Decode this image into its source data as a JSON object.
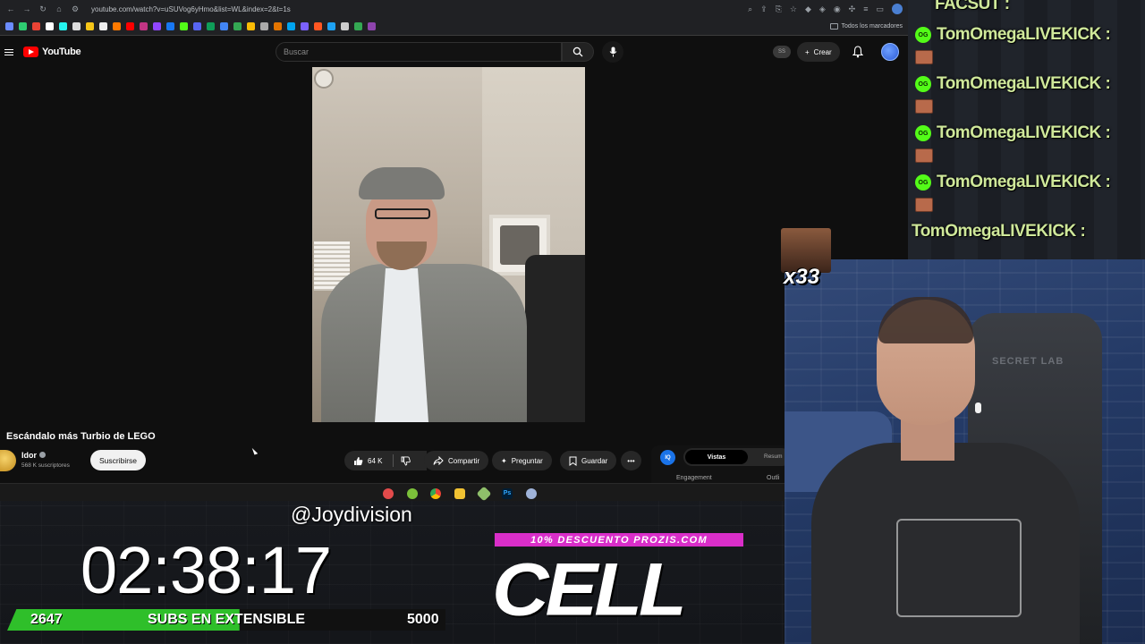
{
  "browser": {
    "url": "youtube.com/watch?v=uSUVog6yHmo&list=WL&index=2&t=1s",
    "bookmarks_folder_label": "Todos los marcadores"
  },
  "youtube": {
    "logo_text": "YouTube",
    "search_placeholder": "Buscar",
    "ss_badge": "SS",
    "create_label": "Crear"
  },
  "video": {
    "title": "Escándalo más Turbio de LEGO",
    "channel": "Idor",
    "subscribers": "568 K suscriptores",
    "subscribe_label": "Suscribirse",
    "likes": "64 K",
    "share_label": "Compartir",
    "ask_label": "Preguntar",
    "save_label": "Guardar"
  },
  "side_panel": {
    "icon_label": "IQ",
    "active_tab": "Vistas",
    "other_tab": "Resum",
    "label_engagement": "Engagement",
    "label_outlier": "Outli"
  },
  "chat": {
    "messages": [
      {
        "user": "FACSUT :"
      },
      {
        "user": "TomOmegaLIVEKICK :"
      },
      {
        "user": "TomOmegaLIVEKICK :"
      },
      {
        "user": "TomOmegaLIVEKICK :"
      },
      {
        "user": "TomOmegaLIVEKICK :"
      },
      {
        "user": "TomOmegaLIVEKICK :"
      }
    ],
    "badge_text": "OG",
    "user_color": "#cfe89a",
    "emote_count": "x33"
  },
  "overlay": {
    "handle": "@Joydivision",
    "timer": "02:38:17",
    "promo": "10% DESCUENTO PROZIS.COM",
    "brand": "CELL",
    "subs_current": "2647",
    "subs_label": "SUBS EN EXTENSIBLE",
    "subs_goal": "5000",
    "subs_progress": 0.53
  },
  "webcam": {
    "chair_brand": "SECRET LAB"
  }
}
